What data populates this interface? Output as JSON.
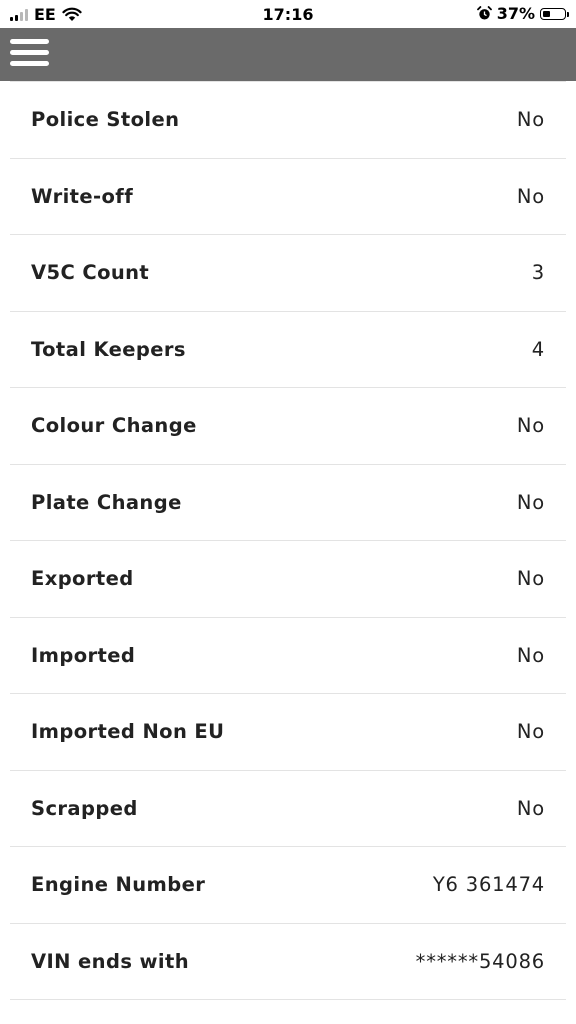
{
  "status_bar": {
    "carrier": "EE",
    "time": "17:16",
    "battery_percent": "37%",
    "battery_level": 0.37,
    "icons": [
      "signal-icon",
      "wifi-icon",
      "alarm-icon",
      "battery-icon"
    ]
  },
  "header": {
    "menu_icon": "hamburger-menu-icon",
    "background_color": "#6a6a6a"
  },
  "details": [
    {
      "label": "Police Stolen",
      "value": "No"
    },
    {
      "label": "Write-off",
      "value": "No"
    },
    {
      "label": "V5C Count",
      "value": "3"
    },
    {
      "label": "Total Keepers",
      "value": "4"
    },
    {
      "label": "Colour Change",
      "value": "No"
    },
    {
      "label": "Plate Change",
      "value": "No"
    },
    {
      "label": "Exported",
      "value": "No"
    },
    {
      "label": "Imported",
      "value": "No"
    },
    {
      "label": "Imported Non EU",
      "value": "No"
    },
    {
      "label": "Scrapped",
      "value": "No"
    },
    {
      "label": "Engine Number",
      "value": "Y6 361474"
    },
    {
      "label": "VIN ends with",
      "value": "******54086"
    }
  ]
}
